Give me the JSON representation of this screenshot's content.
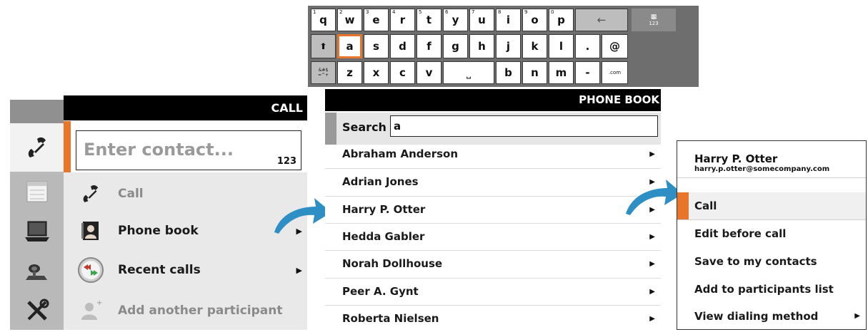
{
  "keyboard": {
    "row1": [
      {
        "key": "q",
        "hint": "1"
      },
      {
        "key": "w",
        "hint": "2"
      },
      {
        "key": "e",
        "hint": "3"
      },
      {
        "key": "r",
        "hint": "4"
      },
      {
        "key": "t",
        "hint": "5"
      },
      {
        "key": "y",
        "hint": "6"
      },
      {
        "key": "u",
        "hint": "7"
      },
      {
        "key": "i",
        "hint": "8"
      },
      {
        "key": "o",
        "hint": "9"
      },
      {
        "key": "p",
        "hint": "0"
      }
    ],
    "row2": [
      "a",
      "s",
      "d",
      "f",
      "g",
      "h",
      "j",
      "k",
      "l",
      ".",
      "@"
    ],
    "row3_left": [
      "z",
      "x",
      "c",
      "v"
    ],
    "row3_right": [
      "b",
      "n",
      "m",
      "-"
    ],
    "backspace": "←",
    "shift": "⬆",
    "symbols": "&#$\n=^+",
    "space": "⎵",
    "dotcom": ".com",
    "numpad_label": "123",
    "numpad_icon": "grid-icon",
    "selected_key": "a"
  },
  "call_panel": {
    "title": "CALL",
    "contact_placeholder": "Enter contact...",
    "contact_suffix": "123",
    "menu": [
      {
        "label": "Call",
        "icon": "phone-handset-icon",
        "enabled": false,
        "arrow": ""
      },
      {
        "label": "Phone book",
        "icon": "phone-book-icon",
        "enabled": true,
        "arrow": "▶"
      },
      {
        "label": "Recent calls",
        "icon": "recent-calls-icon",
        "enabled": true,
        "arrow": "▶"
      },
      {
        "label": "Add another participant",
        "icon": "add-participant-icon",
        "enabled": false,
        "arrow": ""
      }
    ]
  },
  "sidebar": {
    "items": [
      "phone-handset-icon",
      "calendar-icon",
      "laptop-icon",
      "camera-icon",
      "tools-icon"
    ]
  },
  "phone_book": {
    "title": "PHONE BOOK",
    "search_label": "Search",
    "search_value": "a",
    "contacts": [
      {
        "name": "Abraham Anderson",
        "arrow": "▶"
      },
      {
        "name": "Adrian Jones",
        "arrow": "▶"
      },
      {
        "name": "Harry P. Otter",
        "arrow": "▶"
      },
      {
        "name": "Hedda Gabler",
        "arrow": "▶"
      },
      {
        "name": "Norah Dollhouse",
        "arrow": "▶"
      },
      {
        "name": "Peer A. Gynt",
        "arrow": "▶"
      },
      {
        "name": "Roberta Nielsen",
        "arrow": "▶"
      }
    ]
  },
  "contact_detail": {
    "name": "Harry P. Otter",
    "email": "harry.p.otter@somecompany.com",
    "actions": [
      {
        "label": "Call",
        "arrow": ""
      },
      {
        "label": "Edit before call",
        "arrow": ""
      },
      {
        "label": "Save to my contacts",
        "arrow": ""
      },
      {
        "label": "Add to participants list",
        "arrow": ""
      },
      {
        "label": "View dialing method",
        "arrow": "▶"
      }
    ]
  },
  "colors": {
    "accent": "#e8752a",
    "flow_arrow": "#2e8fc4",
    "titlebar": "#000000"
  }
}
